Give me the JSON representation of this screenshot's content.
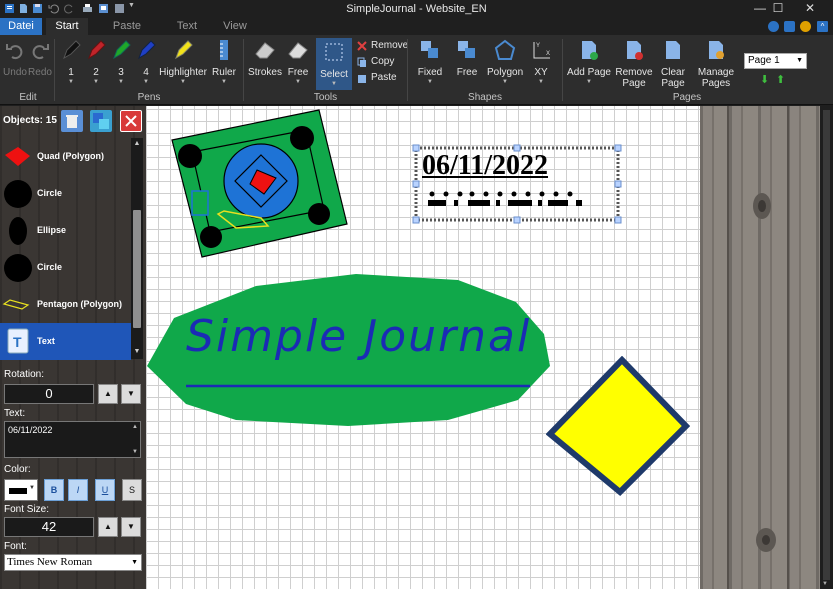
{
  "window": {
    "title": "SimpleJournal - Website_EN"
  },
  "tabs": [
    {
      "label": "Datei"
    },
    {
      "label": "Start"
    },
    {
      "label": "Paste"
    },
    {
      "label": "Text"
    },
    {
      "label": "View"
    }
  ],
  "ribbon": {
    "edit": {
      "group_label": "Edit",
      "undo": "Undo",
      "redo": "Redo"
    },
    "pens": {
      "group_label": "Pens",
      "pen1": "1",
      "pen2": "2",
      "pen3": "3",
      "pen4": "4",
      "highlighter": "Highlighter",
      "ruler": "Ruler",
      "pen_colors": [
        "#111111",
        "#c0242a",
        "#1fa82a",
        "#1f3fc4"
      ]
    },
    "tools": {
      "group_label": "Tools",
      "strokes": "Strokes",
      "free": "Free",
      "select": "Select",
      "remove": "Remove",
      "copy": "Copy",
      "paste": "Paste"
    },
    "shapes": {
      "group_label": "Shapes",
      "fixed": "Fixed",
      "free": "Free",
      "polygon": "Polygon",
      "xy": "XY",
      "xy_axis_y": "Y",
      "xy_axis_x": "X"
    },
    "pages": {
      "group_label": "Pages",
      "add_page": "Add Page",
      "remove_page_line1": "Remove",
      "remove_page_line2": "Page",
      "clear_page_line1": "Clear",
      "clear_page_line2": "Page",
      "manage_pages_line1": "Manage",
      "manage_pages_line2": "Pages",
      "page_select": "Page 1"
    }
  },
  "panel": {
    "objects_label": "Objects: 15",
    "objects": [
      {
        "label": "Quad (Polygon)"
      },
      {
        "label": "Circle"
      },
      {
        "label": "Ellipse"
      },
      {
        "label": "Circle"
      },
      {
        "label": "Pentagon (Polygon)"
      },
      {
        "label": "Text"
      }
    ],
    "rotation_label": "Rotation:",
    "rotation_value": "0",
    "text_label": "Text:",
    "text_value": "06/11/2022",
    "color_label": "Color:",
    "bold": "B",
    "italic": "I",
    "underline": "U",
    "strike": "S",
    "font_size_label": "Font Size:",
    "font_size_value": "42",
    "font_label": "Font:",
    "font_value": "Times New Roman"
  },
  "canvas": {
    "date_text": "06/11/2022",
    "journal_text": "Simple Journal"
  },
  "colors": {
    "accent": "#2b72c4",
    "selection": "#1f56b8",
    "green_shape": "#10a84a",
    "yellow_shape": "#ffff00",
    "navy_border": "#1f3a6a"
  }
}
